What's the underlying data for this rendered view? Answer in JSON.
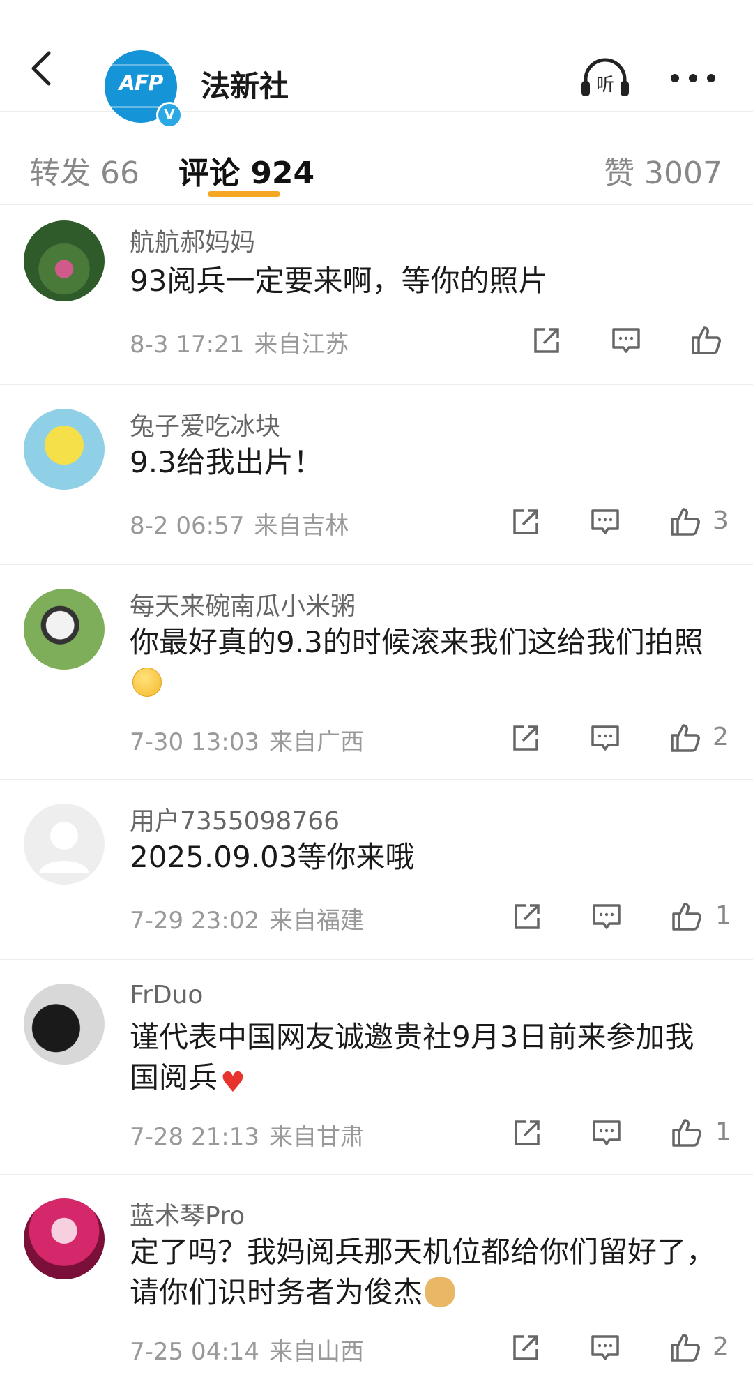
{
  "header": {
    "title": "法新社",
    "avatar_logo_text": "AFP",
    "listen_label": "听"
  },
  "tabs": [
    {
      "label": "转发 66"
    },
    {
      "label": "评论 924"
    },
    {
      "label": "赞 3007"
    }
  ],
  "comments": [
    {
      "user": "航航郝妈妈",
      "text": "93阅兵一定要来啊，等你的照片",
      "time": "8-3 17:21",
      "location": "来自江苏",
      "likes": "",
      "emoji": ""
    },
    {
      "user": "兔子爱吃冰块",
      "text": "9.3给我出片！",
      "time": "8-2 06:57",
      "location": "来自吉林",
      "likes": "3",
      "emoji": ""
    },
    {
      "user": "每天来碗南瓜小米粥",
      "text": "你最好真的9.3的时候滚来我们这给我们拍照",
      "time": "7-30 13:03",
      "location": "来自广西",
      "likes": "2",
      "emoji": "face"
    },
    {
      "user": "用户7355098766",
      "text": "2025.09.03等你来哦",
      "time": "7-29 23:02",
      "location": "来自福建",
      "likes": "1",
      "emoji": ""
    },
    {
      "user": "FrDuo",
      "text": "谨代表中国网友诚邀贵社9月3日前来参加我国阅兵",
      "time": "7-28 21:13",
      "location": "来自甘肃",
      "likes": "1",
      "emoji": "heart"
    },
    {
      "user": "蓝术琴Pro",
      "text": "定了吗？我妈阅兵那天机位都给你们留好了，请你们识时务者为俊杰",
      "time": "7-25 04:14",
      "location": "来自山西",
      "likes": "2",
      "emoji": "doge"
    }
  ],
  "colors": {
    "accent_underline": "#f5a623",
    "afp_blue": "#1594d8",
    "verify_blue": "#2aa8e6",
    "heart_red": "#e8332d"
  },
  "icons": [
    "back-arrow-icon",
    "verified-badge-icon",
    "headphones-icon",
    "more-dots-icon",
    "share-icon",
    "reply-comment-icon",
    "thumbs-up-icon"
  ]
}
